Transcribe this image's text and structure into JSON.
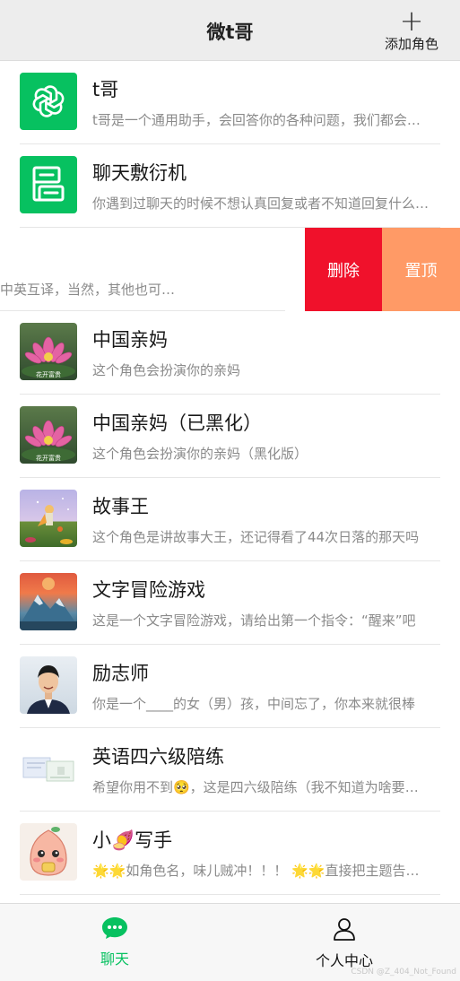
{
  "header": {
    "title": "微t哥",
    "add_label": "添加角色",
    "add_icon": "plus-icon"
  },
  "chats": [
    {
      "name": "t哥",
      "desc": "t哥是一个通用助手，会回答你的各种问题，我们都会帮你解决"
    },
    {
      "name": "聊天敷衍机",
      "desc": "你遇到过聊天的时候不想认真回复或者不知道回复什么的时候吗"
    },
    {
      "name": "",
      "desc": "翻译官，主要用于中英互译，当然，其他也可以哦"
    },
    {
      "name": "中国亲妈",
      "desc": "这个角色会扮演你的亲妈",
      "avatar_caption": "花开富贵"
    },
    {
      "name": "中国亲妈（已黑化）",
      "desc": "这个角色会扮演你的亲妈（黑化版）",
      "avatar_caption": "花开富贵"
    },
    {
      "name": "故事王",
      "desc": "这个角色是讲故事大王，还记得看了44次日落的那天吗"
    },
    {
      "name": "文字冒险游戏",
      "desc": "这是一个文字冒险游戏，请给出第一个指令：“醒来”吧"
    },
    {
      "name": "励志师",
      "desc": "你是一个____的女（男）孩，中间忘了，你本来就很棒"
    },
    {
      "name": "英语四六级陪练",
      "desc": "希望你用不到🥺，这是四六级陪练（我不知道为啥要这个）"
    },
    {
      "name": "小🍠写手",
      "desc": "🌟🌟如角色名，味儿贼冲！！！ 🌟🌟直接把主题告诉我吧"
    }
  ],
  "swipe_actions": {
    "delete": "删除",
    "pin": "置顶"
  },
  "tabbar": {
    "chat": "聊天",
    "profile": "个人中心"
  },
  "watermark": "CSDN @Z_404_Not_Found",
  "colors": {
    "accent": "#07c160",
    "delete": "#f0112b",
    "pin": "#ff9a66",
    "header_bg": "#ededed"
  }
}
